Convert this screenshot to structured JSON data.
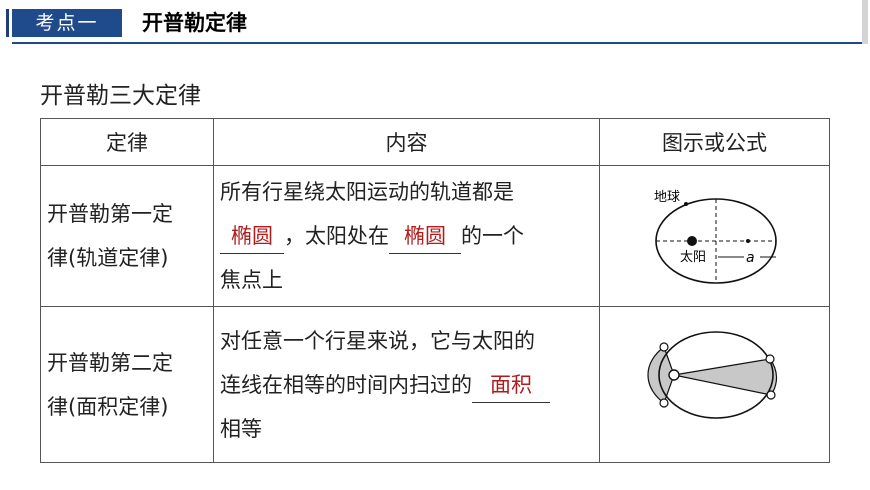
{
  "header": {
    "tag": "考点一",
    "title": "开普勒定律"
  },
  "subtitle": "开普勒三大定律",
  "table": {
    "headers": [
      "定律",
      "内容",
      "图示或公式"
    ],
    "row1": {
      "law_line1": "开普勒第一定",
      "law_line2": "律(轨道定律)",
      "content_line1": "所有行星绕太阳运动的轨道都是",
      "blank1": "椭圆",
      "content_mid": "，太阳处在",
      "blank2": "椭圆",
      "content_end": "的一个",
      "content_line3": "焦点上",
      "fig_label_earth": "地球",
      "fig_label_sun": "太阳",
      "fig_label_a": "a"
    },
    "row2": {
      "law_line1": "开普勒第二定",
      "law_line2": "律(面积定律)",
      "content_line1": "对任意一个行星来说，它与太阳的",
      "content_line2_start": "连线在相等的时间内扫过的",
      "blank": "面积",
      "content_line3": "相等"
    }
  },
  "colors": {
    "accent": "#1f4a8c",
    "answer": "#b01c1c"
  }
}
